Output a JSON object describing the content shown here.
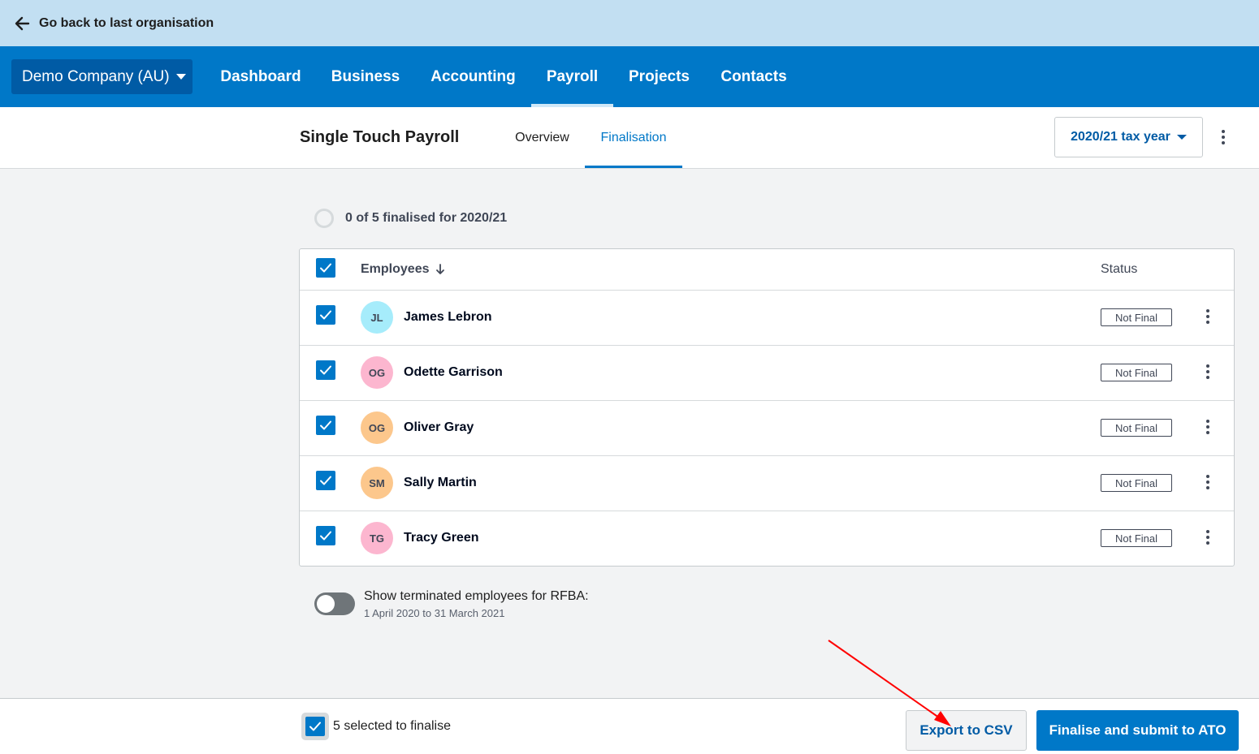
{
  "backbar": {
    "label": "Go back to last organisation",
    "icon": "arrow-left-icon"
  },
  "org": {
    "name": "Demo Company (AU)"
  },
  "nav": {
    "items": [
      {
        "label": "Dashboard",
        "active": false
      },
      {
        "label": "Business",
        "active": false
      },
      {
        "label": "Accounting",
        "active": false
      },
      {
        "label": "Payroll",
        "active": true
      },
      {
        "label": "Projects",
        "active": false
      },
      {
        "label": "Contacts",
        "active": false
      }
    ]
  },
  "page": {
    "title": "Single Touch Payroll",
    "tabs": [
      {
        "label": "Overview",
        "active": false
      },
      {
        "label": "Finalisation",
        "active": true
      }
    ],
    "tax_year": "2020/21 tax year"
  },
  "progress": {
    "text": "0 of 5 finalised for 2020/21"
  },
  "table": {
    "headers": {
      "employees": "Employees",
      "status": "Status"
    },
    "rows": [
      {
        "initials": "JL",
        "name": "James Lebron",
        "status": "Not Final",
        "avatar_color": "#a6ecfb",
        "checked": true
      },
      {
        "initials": "OG",
        "name": "Odette Garrison",
        "status": "Not Final",
        "avatar_color": "#fcb6cf",
        "checked": true
      },
      {
        "initials": "OG",
        "name": "Oliver Gray",
        "status": "Not Final",
        "avatar_color": "#fcc78c",
        "checked": true
      },
      {
        "initials": "SM",
        "name": "Sally Martin",
        "status": "Not Final",
        "avatar_color": "#fcc78c",
        "checked": true
      },
      {
        "initials": "TG",
        "name": "Tracy Green",
        "status": "Not Final",
        "avatar_color": "#fcb6cf",
        "checked": true
      }
    ]
  },
  "toggle": {
    "label": "Show terminated employees for RFBA:",
    "sublabel": "1 April 2020 to 31 March 2021",
    "on": false
  },
  "footer": {
    "selected_text": "5 selected to finalise",
    "export_label": "Export to CSV",
    "finalise_label": "Finalise and submit to ATO"
  },
  "colors": {
    "brand": "#0078c8",
    "brand_dark": "#005ba5",
    "backbar": "#c2dff2",
    "annotation_arrow": "#ff0000"
  }
}
